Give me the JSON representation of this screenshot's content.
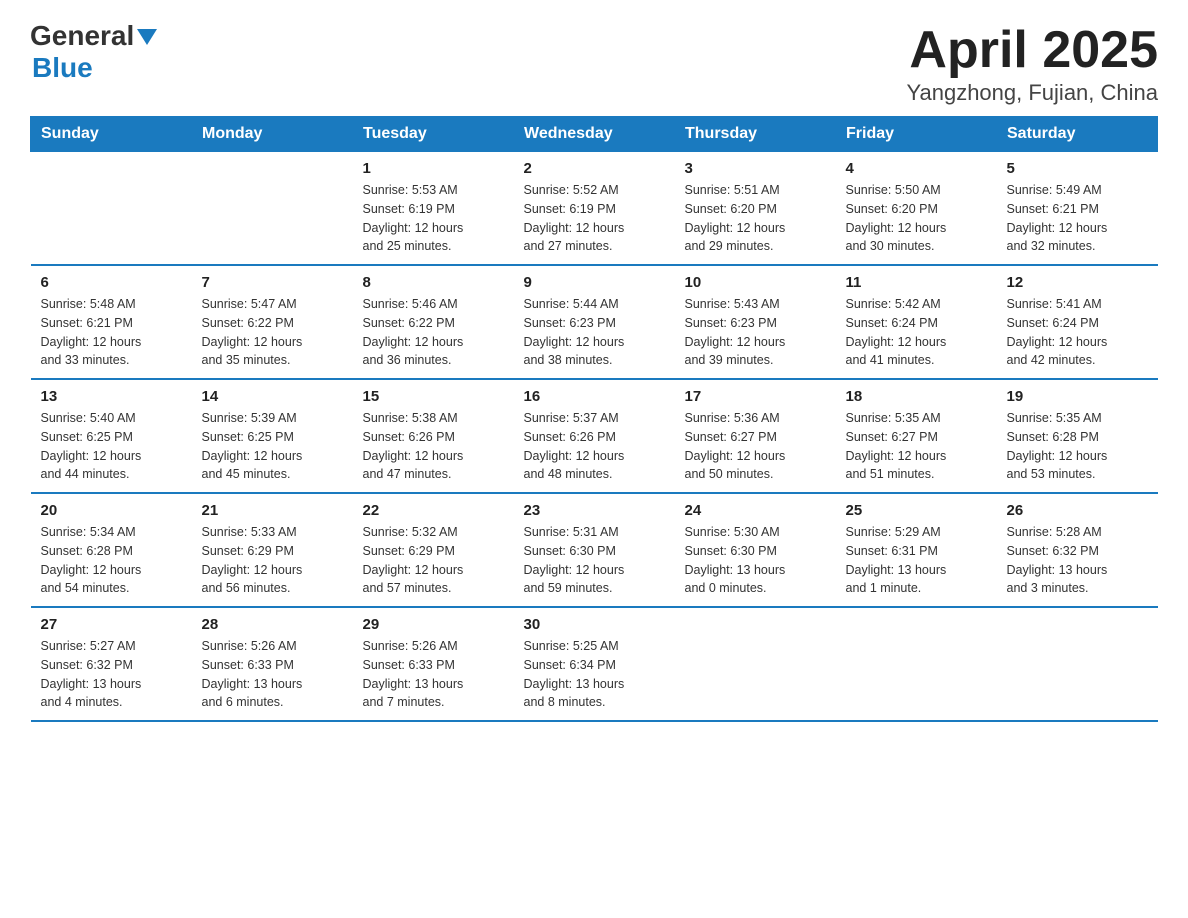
{
  "logo": {
    "general": "General",
    "blue": "Blue"
  },
  "title": "April 2025",
  "subtitle": "Yangzhong, Fujian, China",
  "weekdays": [
    "Sunday",
    "Monday",
    "Tuesday",
    "Wednesday",
    "Thursday",
    "Friday",
    "Saturday"
  ],
  "weeks": [
    [
      {
        "day": "",
        "info": ""
      },
      {
        "day": "",
        "info": ""
      },
      {
        "day": "1",
        "info": "Sunrise: 5:53 AM\nSunset: 6:19 PM\nDaylight: 12 hours\nand 25 minutes."
      },
      {
        "day": "2",
        "info": "Sunrise: 5:52 AM\nSunset: 6:19 PM\nDaylight: 12 hours\nand 27 minutes."
      },
      {
        "day": "3",
        "info": "Sunrise: 5:51 AM\nSunset: 6:20 PM\nDaylight: 12 hours\nand 29 minutes."
      },
      {
        "day": "4",
        "info": "Sunrise: 5:50 AM\nSunset: 6:20 PM\nDaylight: 12 hours\nand 30 minutes."
      },
      {
        "day": "5",
        "info": "Sunrise: 5:49 AM\nSunset: 6:21 PM\nDaylight: 12 hours\nand 32 minutes."
      }
    ],
    [
      {
        "day": "6",
        "info": "Sunrise: 5:48 AM\nSunset: 6:21 PM\nDaylight: 12 hours\nand 33 minutes."
      },
      {
        "day": "7",
        "info": "Sunrise: 5:47 AM\nSunset: 6:22 PM\nDaylight: 12 hours\nand 35 minutes."
      },
      {
        "day": "8",
        "info": "Sunrise: 5:46 AM\nSunset: 6:22 PM\nDaylight: 12 hours\nand 36 minutes."
      },
      {
        "day": "9",
        "info": "Sunrise: 5:44 AM\nSunset: 6:23 PM\nDaylight: 12 hours\nand 38 minutes."
      },
      {
        "day": "10",
        "info": "Sunrise: 5:43 AM\nSunset: 6:23 PM\nDaylight: 12 hours\nand 39 minutes."
      },
      {
        "day": "11",
        "info": "Sunrise: 5:42 AM\nSunset: 6:24 PM\nDaylight: 12 hours\nand 41 minutes."
      },
      {
        "day": "12",
        "info": "Sunrise: 5:41 AM\nSunset: 6:24 PM\nDaylight: 12 hours\nand 42 minutes."
      }
    ],
    [
      {
        "day": "13",
        "info": "Sunrise: 5:40 AM\nSunset: 6:25 PM\nDaylight: 12 hours\nand 44 minutes."
      },
      {
        "day": "14",
        "info": "Sunrise: 5:39 AM\nSunset: 6:25 PM\nDaylight: 12 hours\nand 45 minutes."
      },
      {
        "day": "15",
        "info": "Sunrise: 5:38 AM\nSunset: 6:26 PM\nDaylight: 12 hours\nand 47 minutes."
      },
      {
        "day": "16",
        "info": "Sunrise: 5:37 AM\nSunset: 6:26 PM\nDaylight: 12 hours\nand 48 minutes."
      },
      {
        "day": "17",
        "info": "Sunrise: 5:36 AM\nSunset: 6:27 PM\nDaylight: 12 hours\nand 50 minutes."
      },
      {
        "day": "18",
        "info": "Sunrise: 5:35 AM\nSunset: 6:27 PM\nDaylight: 12 hours\nand 51 minutes."
      },
      {
        "day": "19",
        "info": "Sunrise: 5:35 AM\nSunset: 6:28 PM\nDaylight: 12 hours\nand 53 minutes."
      }
    ],
    [
      {
        "day": "20",
        "info": "Sunrise: 5:34 AM\nSunset: 6:28 PM\nDaylight: 12 hours\nand 54 minutes."
      },
      {
        "day": "21",
        "info": "Sunrise: 5:33 AM\nSunset: 6:29 PM\nDaylight: 12 hours\nand 56 minutes."
      },
      {
        "day": "22",
        "info": "Sunrise: 5:32 AM\nSunset: 6:29 PM\nDaylight: 12 hours\nand 57 minutes."
      },
      {
        "day": "23",
        "info": "Sunrise: 5:31 AM\nSunset: 6:30 PM\nDaylight: 12 hours\nand 59 minutes."
      },
      {
        "day": "24",
        "info": "Sunrise: 5:30 AM\nSunset: 6:30 PM\nDaylight: 13 hours\nand 0 minutes."
      },
      {
        "day": "25",
        "info": "Sunrise: 5:29 AM\nSunset: 6:31 PM\nDaylight: 13 hours\nand 1 minute."
      },
      {
        "day": "26",
        "info": "Sunrise: 5:28 AM\nSunset: 6:32 PM\nDaylight: 13 hours\nand 3 minutes."
      }
    ],
    [
      {
        "day": "27",
        "info": "Sunrise: 5:27 AM\nSunset: 6:32 PM\nDaylight: 13 hours\nand 4 minutes."
      },
      {
        "day": "28",
        "info": "Sunrise: 5:26 AM\nSunset: 6:33 PM\nDaylight: 13 hours\nand 6 minutes."
      },
      {
        "day": "29",
        "info": "Sunrise: 5:26 AM\nSunset: 6:33 PM\nDaylight: 13 hours\nand 7 minutes."
      },
      {
        "day": "30",
        "info": "Sunrise: 5:25 AM\nSunset: 6:34 PM\nDaylight: 13 hours\nand 8 minutes."
      },
      {
        "day": "",
        "info": ""
      },
      {
        "day": "",
        "info": ""
      },
      {
        "day": "",
        "info": ""
      }
    ]
  ]
}
